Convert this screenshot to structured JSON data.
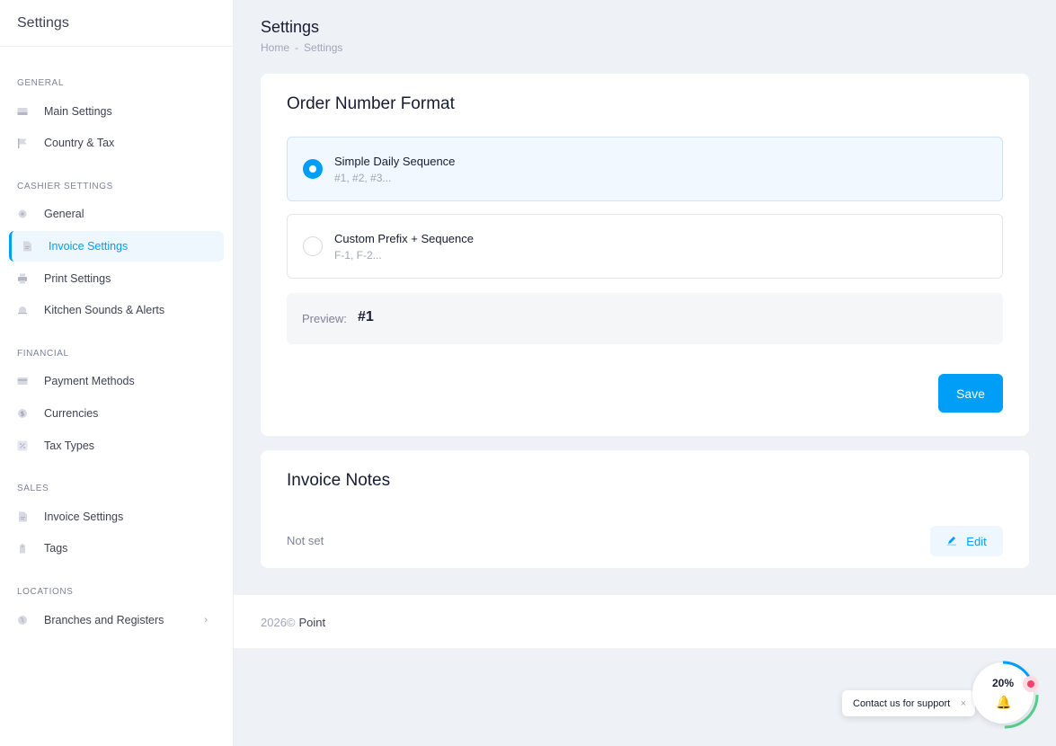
{
  "sidebar": {
    "title": "Settings",
    "sections": [
      {
        "label": "GENERAL"
      },
      {
        "label": "CASHIER SETTINGS"
      },
      {
        "label": "FINANCIAL"
      },
      {
        "label": "SALES"
      },
      {
        "label": "LOCATIONS"
      }
    ],
    "items": [
      {
        "label": "Main Settings",
        "icon": "window-icon"
      },
      {
        "label": "Country & Tax",
        "icon": "flag-icon"
      },
      {
        "label": "General",
        "icon": "gear-icon"
      },
      {
        "label": "Invoice Settings",
        "icon": "document-icon",
        "active": true
      },
      {
        "label": "Print Settings",
        "icon": "printer-icon"
      },
      {
        "label": "Kitchen Sounds & Alerts",
        "icon": "bell-icon"
      },
      {
        "label": "Payment Methods",
        "icon": "credit-card-icon"
      },
      {
        "label": "Currencies",
        "icon": "dollar-icon"
      },
      {
        "label": "Tax Types",
        "icon": "percent-icon"
      },
      {
        "label": "Invoice Settings",
        "icon": "document-icon"
      },
      {
        "label": "Tags",
        "icon": "tag-icon"
      },
      {
        "label": "Branches and Registers",
        "icon": "globe-icon"
      }
    ]
  },
  "header": {
    "title": "Settings",
    "breadcrumb": [
      "Home",
      "Settings"
    ],
    "breadcrumb_separator": "-"
  },
  "order_format": {
    "title": "Order Number Format",
    "options": [
      {
        "title": "Simple Daily Sequence",
        "example": "#1, #2, #3...",
        "selected": true
      },
      {
        "title": "Custom Prefix + Sequence",
        "example": "F-1, F-2...",
        "selected": false
      }
    ],
    "preview_label": "Preview:",
    "preview_value": "#1",
    "save_label": "Save"
  },
  "invoice_notes": {
    "title": "Invoice Notes",
    "value": "Not set",
    "edit_label": "Edit"
  },
  "footer": {
    "year": "2026©",
    "brand": "Point"
  },
  "support": {
    "label": "Contact us for support",
    "close": "×",
    "progress_label": "20%",
    "progress": 0.2
  },
  "colors": {
    "accent": "#009ef7",
    "success": "#50cd89",
    "danger": "#f1416c"
  }
}
